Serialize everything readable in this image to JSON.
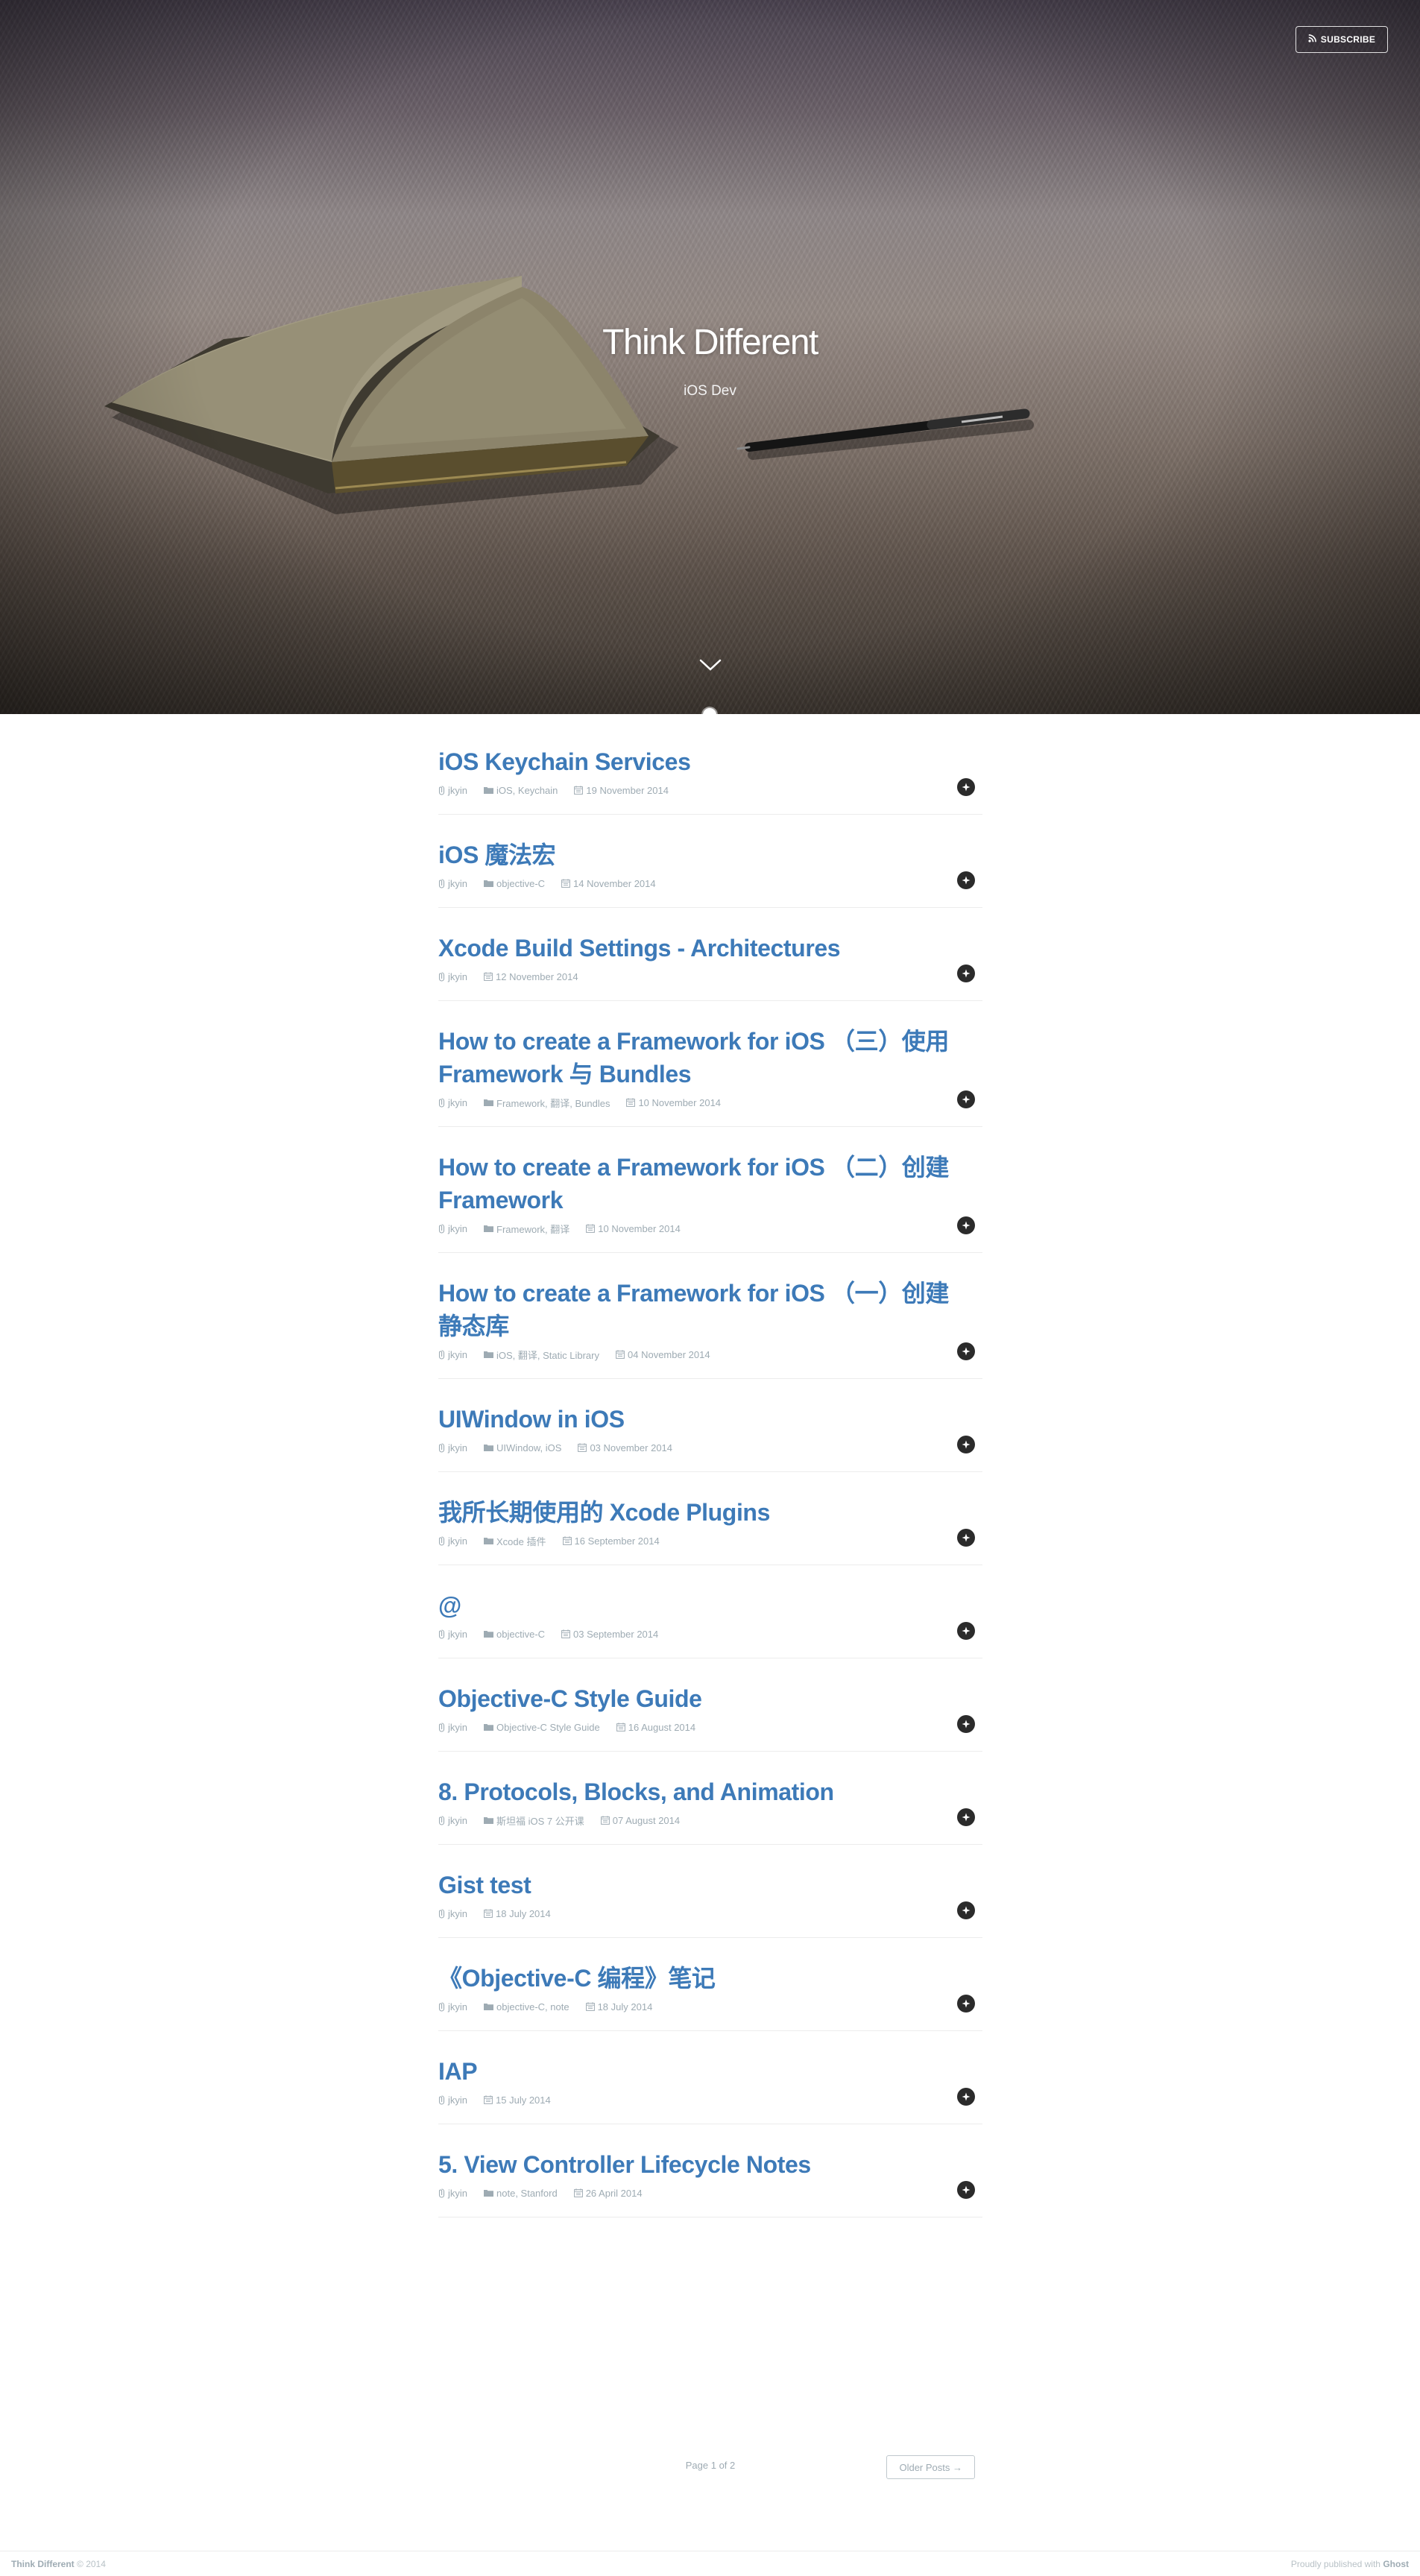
{
  "header": {
    "subscribe_label": "SUBSCRIBE",
    "blog_title": "Think Different",
    "blog_description": "iOS Dev"
  },
  "colors": {
    "link": "#3d7ab8",
    "meta": "#9eabb3",
    "divider": "#ececec"
  },
  "posts": [
    {
      "title": "iOS Keychain Services",
      "author": "jkyin",
      "tags": "iOS, Keychain",
      "date": "19 November 2014"
    },
    {
      "title": "iOS 魔法宏",
      "author": "jkyin",
      "tags": "objective-C",
      "date": "14 November 2014"
    },
    {
      "title": "Xcode Build Settings - Architectures",
      "author": "jkyin",
      "tags": "",
      "date": "12 November 2014"
    },
    {
      "title": "How to create a Framework for iOS （三）使用 Framework 与 Bundles",
      "author": "jkyin",
      "tags": "Framework, 翻译, Bundles",
      "date": "10 November 2014"
    },
    {
      "title": "How to create a Framework for iOS （二）创建 Framework",
      "author": "jkyin",
      "tags": "Framework, 翻译",
      "date": "10 November 2014"
    },
    {
      "title": "How to create a Framework for iOS （一）创建 静态库",
      "author": "jkyin",
      "tags": "iOS, 翻译, Static Library",
      "date": "04 November 2014"
    },
    {
      "title": "UIWindow in iOS",
      "author": "jkyin",
      "tags": "UIWindow, iOS",
      "date": "03 November 2014"
    },
    {
      "title": "我所长期使用的 Xcode Plugins",
      "author": "jkyin",
      "tags": "Xcode 插件",
      "date": "16 September 2014"
    },
    {
      "title": "@",
      "author": "jkyin",
      "tags": "objective-C",
      "date": "03 September 2014"
    },
    {
      "title": "Objective-C Style Guide",
      "author": "jkyin",
      "tags": "Objective-C Style Guide",
      "date": "16 August 2014"
    },
    {
      "title": "8. Protocols, Blocks, and Animation",
      "author": "jkyin",
      "tags": "斯坦福 iOS 7 公开课",
      "date": "07 August 2014"
    },
    {
      "title": "Gist test",
      "author": "jkyin",
      "tags": "",
      "date": "18 July 2014"
    },
    {
      "title": "《Objective-C 编程》笔记",
      "author": "jkyin",
      "tags": "objective-C, note",
      "date": "18 July 2014"
    },
    {
      "title": "IAP",
      "author": "jkyin",
      "tags": "",
      "date": "15 July 2014"
    },
    {
      "title": "5. View Controller Lifecycle Notes",
      "author": "jkyin",
      "tags": "note, Stanford",
      "date": "26 April 2014"
    }
  ],
  "pagination": {
    "page_number": "Page 1 of 2",
    "older_label": "Older Posts →"
  },
  "footer": {
    "site_name": "Think Different",
    "copyright": "© 2014",
    "published_prefix": "Proudly published with",
    "engine": "Ghost"
  }
}
